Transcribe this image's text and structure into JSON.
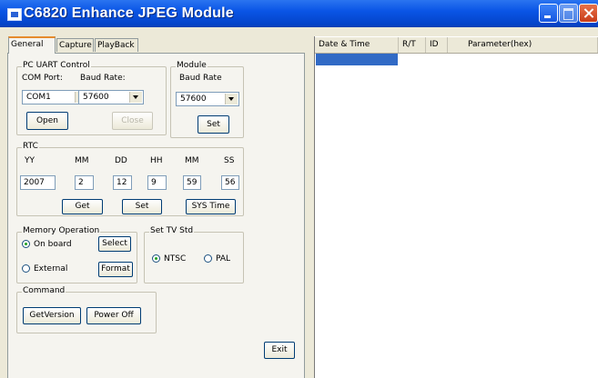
{
  "window": {
    "title": "C6820 Enhance JPEG Module"
  },
  "tabs": [
    {
      "label": "General"
    },
    {
      "label": "Capture"
    },
    {
      "label": "PlayBack"
    }
  ],
  "pc_uart": {
    "title": "PC UART Control",
    "com_port_label": "COM Port:",
    "baud_rate_label": "Baud Rate:",
    "com_port_value": "COM1",
    "baud_rate_value": "57600",
    "open_label": "Open",
    "close_label": "Close"
  },
  "module": {
    "title": "Module",
    "baud_rate_label": "Baud Rate",
    "baud_rate_value": "57600",
    "set_label": "Set"
  },
  "rtc": {
    "title": "RTC",
    "fields": [
      {
        "label": "YY",
        "value": "2007"
      },
      {
        "label": "MM",
        "value": "2"
      },
      {
        "label": "DD",
        "value": "12"
      },
      {
        "label": "HH",
        "value": "9"
      },
      {
        "label": "MM",
        "value": "59"
      },
      {
        "label": "SS",
        "value": "56"
      }
    ],
    "get_label": "Get",
    "set_label": "Set",
    "sys_time_label": "SYS Time"
  },
  "memory": {
    "title": "Memory Operation",
    "onboard_label": "On board",
    "external_label": "External",
    "select_label": "Select",
    "format_label": "Format"
  },
  "tvstd": {
    "title": "Set TV Std",
    "ntsc_label": "NTSC",
    "pal_label": "PAL"
  },
  "command": {
    "title": "Command",
    "get_version_label": "GetVersion",
    "power_off_label": "Power Off"
  },
  "exit_label": "Exit",
  "log_table": {
    "columns": [
      "Date & Time",
      "R/T",
      "ID",
      "Parameter(hex)"
    ]
  }
}
